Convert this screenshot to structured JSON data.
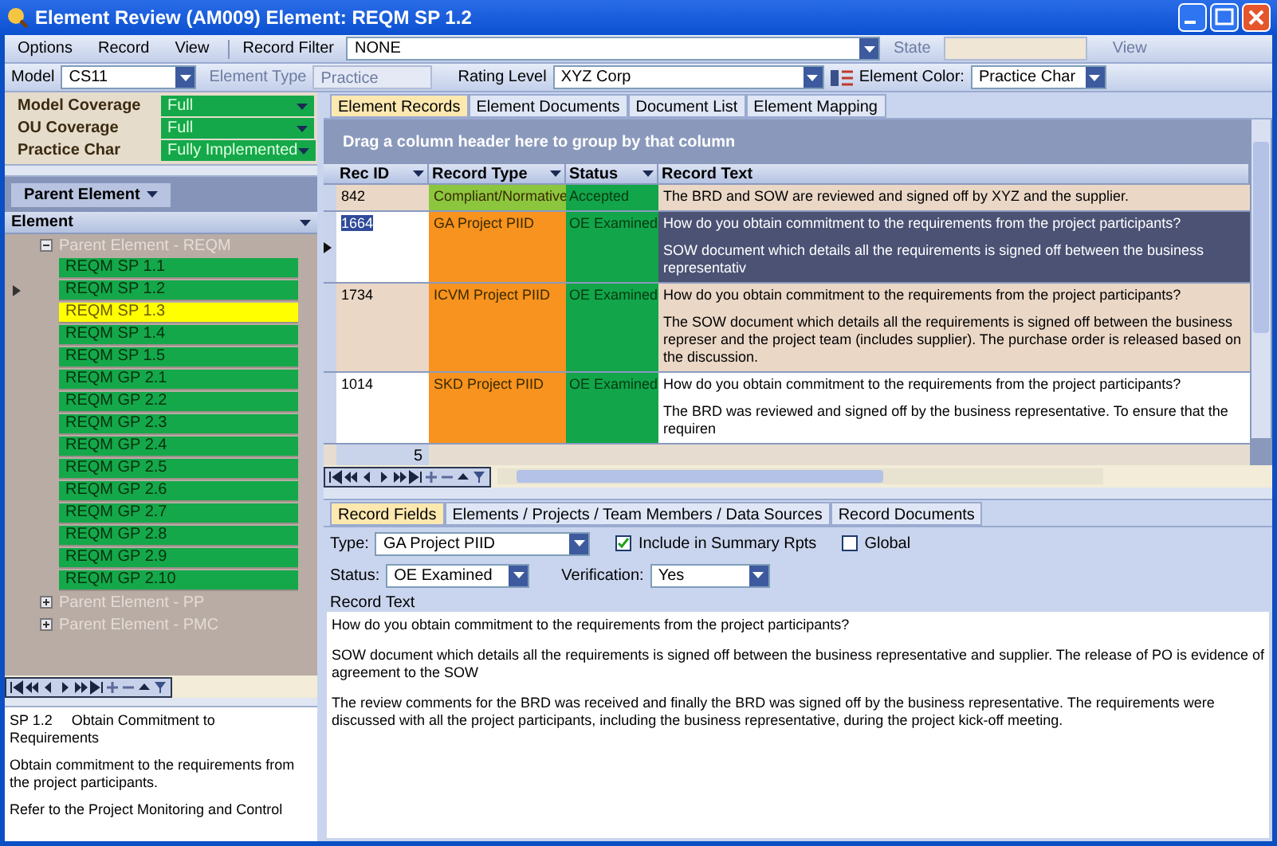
{
  "window": {
    "title": "Element Review (AM009) Element: REQM SP 1.2"
  },
  "menu": [
    "Options",
    "Record",
    "View"
  ],
  "record_filter": {
    "label": "Record Filter",
    "value": "NONE"
  },
  "state_filter": {
    "label": "State",
    "disabled": true
  },
  "view_button": {
    "label": "View",
    "disabled": true
  },
  "model": {
    "label": "Model",
    "value": "CS11"
  },
  "element_type": {
    "label": "Element Type",
    "value": "Practice",
    "disabled": true
  },
  "rating_level": {
    "label": "Rating Level",
    "value": "XYZ Corp"
  },
  "element_color": {
    "label": "Element Color:",
    "value": "Practice Char"
  },
  "coverage": [
    {
      "label": "Model Coverage",
      "value": "Full",
      "color": "#14a84a"
    },
    {
      "label": "OU Coverage",
      "value": "Full",
      "color": "#14a84a"
    },
    {
      "label": "Practice Char",
      "value": "Fully Implemented",
      "color": "#14a84a"
    }
  ],
  "group_box": "Parent Element",
  "tree": {
    "header": "Element",
    "groups": [
      {
        "label": "Parent Element - REQM",
        "expanded": true,
        "children": [
          {
            "label": "REQM SP 1.1",
            "selected": false,
            "color": "#14a84a"
          },
          {
            "label": "REQM SP 1.2",
            "selected": true,
            "color": "#14a84a"
          },
          {
            "label": "REQM SP 1.3",
            "selected": false,
            "color": "#ffff00"
          },
          {
            "label": "REQM SP 1.4",
            "selected": false,
            "color": "#14a84a"
          },
          {
            "label": "REQM SP 1.5",
            "selected": false,
            "color": "#14a84a"
          },
          {
            "label": "REQM GP 2.1",
            "selected": false,
            "color": "#14a84a"
          },
          {
            "label": "REQM GP 2.2",
            "selected": false,
            "color": "#14a84a"
          },
          {
            "label": "REQM GP 2.3",
            "selected": false,
            "color": "#14a84a"
          },
          {
            "label": "REQM GP 2.4",
            "selected": false,
            "color": "#14a84a"
          },
          {
            "label": "REQM GP 2.5",
            "selected": false,
            "color": "#14a84a"
          },
          {
            "label": "REQM GP 2.6",
            "selected": false,
            "color": "#14a84a"
          },
          {
            "label": "REQM GP 2.7",
            "selected": false,
            "color": "#14a84a"
          },
          {
            "label": "REQM GP 2.8",
            "selected": false,
            "color": "#14a84a"
          },
          {
            "label": "REQM GP 2.9",
            "selected": false,
            "color": "#14a84a"
          },
          {
            "label": "REQM GP 2.10",
            "selected": false,
            "color": "#14a84a"
          }
        ]
      },
      {
        "label": "Parent Element - PP",
        "expanded": false
      },
      {
        "label": "Parent Element - PMC",
        "expanded": false
      }
    ]
  },
  "description": {
    "code": "SP 1.2",
    "title": "Obtain Commitment to Requirements",
    "paragraphs": [
      "Obtain commitment to the requirements from the project participants.",
      "Refer to the Project Monitoring and Control"
    ]
  },
  "record_tabs": [
    {
      "label": "Element Records",
      "selected": true
    },
    {
      "label": "Element Documents",
      "selected": false
    },
    {
      "label": "Document List",
      "selected": false
    },
    {
      "label": "Element Mapping",
      "selected": false
    }
  ],
  "group_hint": "Drag a column header here to group by that column",
  "grid": {
    "columns": [
      "Rec ID",
      "Record Type",
      "Status",
      "Record Text"
    ],
    "rows": [
      {
        "rec_id": "842",
        "record_type": {
          "text": "Compliant/Normative",
          "color": "#8cc63e"
        },
        "status": {
          "text": "Accepted",
          "color": "#12a54a"
        },
        "text": [
          "The BRD and SOW are reviewed and signed off by XYZ and the supplier."
        ],
        "selected": false
      },
      {
        "rec_id": "1664",
        "record_type": {
          "text": "GA Project PIID",
          "color": "#f7931e"
        },
        "status": {
          "text": "OE Examined",
          "color": "#12a54a"
        },
        "text": [
          "How do you obtain commitment to the requirements from the project participants?",
          "SOW document which details all the requirements is signed off between the business representativ"
        ],
        "selected": true
      },
      {
        "rec_id": "1734",
        "record_type": {
          "text": "ICVM Project PIID",
          "color": "#f7931e"
        },
        "status": {
          "text": "OE Examined",
          "color": "#12a54a"
        },
        "text": [
          "How do you obtain commitment to the requirements from the project participants?",
          "The SOW document which details all the requirements is signed off between the business represer and the project team (includes supplier). The purchase order is released based on the discussion."
        ],
        "selected": false
      },
      {
        "rec_id": "1014",
        "record_type": {
          "text": "SKD Project PIID",
          "color": "#f7931e"
        },
        "status": {
          "text": "OE Examined",
          "color": "#12a54a"
        },
        "text": [
          "How do you obtain commitment to the requirements from the project participants?",
          "The BRD was reviewed and signed off by the business representative. To ensure that the requiren"
        ],
        "selected": false
      }
    ],
    "count": "5"
  },
  "detail_tabs": [
    {
      "label": "Record Fields",
      "selected": true
    },
    {
      "label": "Elements / Projects / Team Members / Data Sources",
      "selected": false
    },
    {
      "label": "Record Documents",
      "selected": false
    }
  ],
  "form": {
    "type": {
      "label": "Type:",
      "value": "GA Project PIID"
    },
    "include_summary": {
      "label": "Include in Summary Rpts",
      "checked": true
    },
    "global": {
      "label": "Global",
      "checked": false
    },
    "status": {
      "label": "Status:",
      "value": "OE Examined"
    },
    "verification": {
      "label": "Verification:",
      "value": "Yes"
    },
    "record_text_label": "Record Text",
    "record_text": [
      "How do you obtain commitment to the requirements from the project participants?",
      "SOW document which details all the requirements is signed off between the business representative and supplier. The release of PO is evidence of agreement to the SOW",
      "The review comments for the BRD was received and finally the BRD was signed off by the business representative. The requirements were discussed with all the project participants, including the business representative, during the project kick-off meeting."
    ]
  }
}
